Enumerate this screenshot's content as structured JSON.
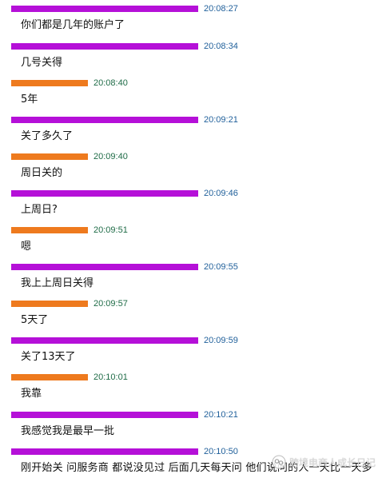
{
  "colors": {
    "purple_bar": "#b510d8",
    "orange_bar": "#ee7a1e",
    "time_purple": "#1f5f9a",
    "time_orange": "#1e6b46",
    "text": "#111111"
  },
  "messages": [
    {
      "sender": "purple",
      "time": "20:08:27",
      "text": "你们都是几年的账户了"
    },
    {
      "sender": "purple",
      "time": "20:08:34",
      "text": "几号关得"
    },
    {
      "sender": "orange",
      "time": "20:08:40",
      "text": "5年"
    },
    {
      "sender": "purple",
      "time": "20:09:21",
      "text": "关了多久了"
    },
    {
      "sender": "orange",
      "time": "20:09:40",
      "text": "周日关的"
    },
    {
      "sender": "purple",
      "time": "20:09:46",
      "text": "上周日?"
    },
    {
      "sender": "orange",
      "time": "20:09:51",
      "text": "嗯"
    },
    {
      "sender": "purple",
      "time": "20:09:55",
      "text": "我上上周日关得"
    },
    {
      "sender": "orange",
      "time": "20:09:57",
      "text": "5天了"
    },
    {
      "sender": "purple",
      "time": "20:09:59",
      "text": "关了13天了"
    },
    {
      "sender": "orange",
      "time": "20:10:01",
      "text": "我靠"
    },
    {
      "sender": "purple",
      "time": "20:10:21",
      "text": "我感觉我是最早一批"
    },
    {
      "sender": "purple",
      "time": "20:10:50",
      "text": "刚开始关  问服务商  都说没见过  后面几天每天问  他们说问的人一天比一天多"
    }
  ],
  "watermark": {
    "icon": "wechat-channel-icon",
    "text": "跨境电商人成长日记"
  }
}
